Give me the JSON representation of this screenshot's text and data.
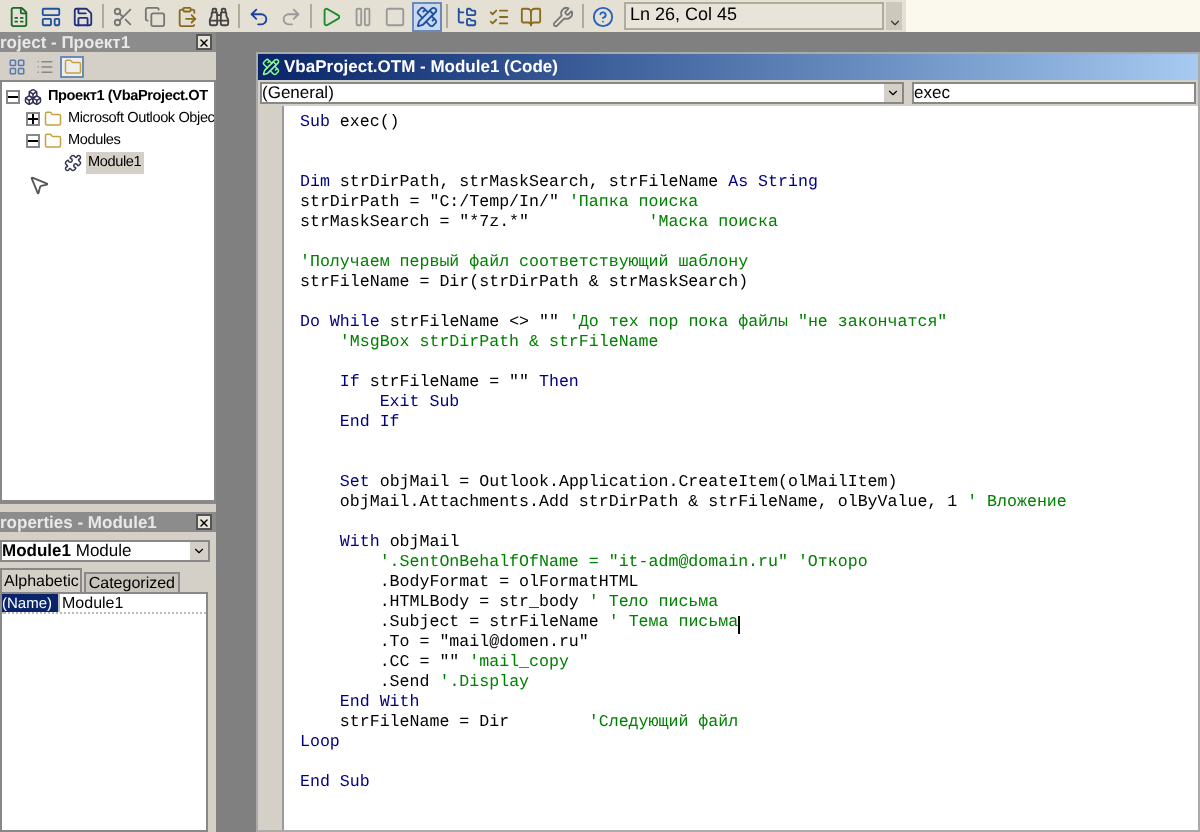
{
  "toolbar": {
    "buttons": [
      {
        "pressed": false
      },
      {
        "pressed": false
      },
      {
        "pressed": false
      },
      {
        "pressed": false
      },
      {
        "pressed": false
      },
      {
        "pressed": false
      },
      {
        "pressed": false
      },
      {
        "pressed": false
      },
      {
        "pressed": false
      },
      {
        "pressed": false
      },
      {
        "pressed": false
      },
      {
        "pressed": false
      },
      {
        "pressed": true
      },
      {
        "pressed": false
      },
      {
        "pressed": false
      },
      {
        "pressed": false
      },
      {
        "pressed": false
      },
      {
        "pressed": false
      }
    ],
    "position": "Ln 26, Col 45"
  },
  "project_explorer": {
    "title": "roject - Проект1",
    "tree": [
      {
        "label": "Проект1 (VbaProject.OT",
        "expanded": true,
        "selected": false,
        "children": [
          {
            "label": "Microsoft Outlook Objec",
            "expanded": false,
            "selected": false
          },
          {
            "label": "Modules",
            "expanded": true,
            "selected": false,
            "children": [
              {
                "label": "Module1",
                "selected": true
              }
            ]
          }
        ]
      }
    ]
  },
  "properties": {
    "title": "roperties - Module1",
    "object_name": "Module1",
    "object_type": "Module",
    "tabs": [
      {
        "label": "Alphabetic",
        "selected": true
      },
      {
        "label": "Categorized",
        "selected": false
      }
    ],
    "rows": [
      {
        "name": "(Name)",
        "value": "Module1",
        "selected": true
      }
    ]
  },
  "code_window": {
    "title": "VbaProject.OTM - Module1 (Code)",
    "object_combo": "(General)",
    "procedure_combo": "exec",
    "lines": [
      {
        "kind": "code",
        "segments": [
          {
            "kind": "keyword",
            "text": "Sub"
          },
          {
            "kind": "plain",
            "text": " exec()"
          }
        ]
      },
      {
        "kind": "blank"
      },
      {
        "kind": "blank"
      },
      {
        "kind": "code",
        "segments": [
          {
            "kind": "keyword",
            "text": "Dim"
          },
          {
            "kind": "plain",
            "text": " strDirPath, strMaskSearch, strFileName "
          },
          {
            "kind": "keyword",
            "text": "As String"
          }
        ]
      },
      {
        "kind": "code",
        "segments": [
          {
            "kind": "plain",
            "text": "strDirPath = \"C:/Temp/In/\" "
          },
          {
            "kind": "comment",
            "text": "'Папка поиска"
          }
        ]
      },
      {
        "kind": "code",
        "segments": [
          {
            "kind": "plain",
            "text": "strMaskSearch = \"*7z.*\"            "
          },
          {
            "kind": "comment",
            "text": "'Маска поиска"
          }
        ]
      },
      {
        "kind": "blank"
      },
      {
        "kind": "code",
        "segments": [
          {
            "kind": "comment",
            "text": "'Получаем первый файл соответствующий шаблону"
          }
        ]
      },
      {
        "kind": "code",
        "segments": [
          {
            "kind": "plain",
            "text": "strFileName = Dir(strDirPath & strMaskSearch)"
          }
        ]
      },
      {
        "kind": "blank"
      },
      {
        "kind": "code",
        "segments": [
          {
            "kind": "keyword",
            "text": "Do While"
          },
          {
            "kind": "plain",
            "text": " strFileName <> \"\" "
          },
          {
            "kind": "comment",
            "text": "'До тех пор пока файлы \"не закончатся\""
          }
        ]
      },
      {
        "kind": "code",
        "segments": [
          {
            "kind": "comment",
            "text": "    'MsgBox strDirPath & strFileName"
          }
        ]
      },
      {
        "kind": "blank"
      },
      {
        "kind": "code",
        "segments": [
          {
            "kind": "keyword",
            "text": "    If"
          },
          {
            "kind": "plain",
            "text": " strFileName = \"\" "
          },
          {
            "kind": "keyword",
            "text": "Then"
          }
        ]
      },
      {
        "kind": "code",
        "segments": [
          {
            "kind": "keyword",
            "text": "        Exit Sub"
          }
        ]
      },
      {
        "kind": "code",
        "segments": [
          {
            "kind": "keyword",
            "text": "    End If"
          }
        ]
      },
      {
        "kind": "blank"
      },
      {
        "kind": "blank"
      },
      {
        "kind": "code",
        "segments": [
          {
            "kind": "keyword",
            "text": "    Set"
          },
          {
            "kind": "plain",
            "text": " objMail = Outlook.Application.CreateItem(olMailItem)"
          }
        ]
      },
      {
        "kind": "code",
        "segments": [
          {
            "kind": "plain",
            "text": "    objMail.Attachments.Add strDirPath & strFileName, olByValue, 1 "
          },
          {
            "kind": "comment",
            "text": "' Вложение"
          }
        ]
      },
      {
        "kind": "blank"
      },
      {
        "kind": "code",
        "segments": [
          {
            "kind": "keyword",
            "text": "    With"
          },
          {
            "kind": "plain",
            "text": " objMail"
          }
        ]
      },
      {
        "kind": "code",
        "segments": [
          {
            "kind": "comment",
            "text": "        '.SentOnBehalfOfName = \"it-adm@domain.ru\" 'Откоро"
          }
        ]
      },
      {
        "kind": "code",
        "segments": [
          {
            "kind": "plain",
            "text": "        .BodyFormat = olFormatHTML"
          }
        ]
      },
      {
        "kind": "code",
        "segments": [
          {
            "kind": "plain",
            "text": "        .HTMLBody = str_body "
          },
          {
            "kind": "comment",
            "text": "' Тело письма"
          }
        ]
      },
      {
        "kind": "code",
        "segments": [
          {
            "kind": "plain",
            "text": "        .Subject = strFileName "
          },
          {
            "kind": "comment",
            "text": "' Тема письма"
          }
        ],
        "cursor": true
      },
      {
        "kind": "code",
        "segments": [
          {
            "kind": "plain",
            "text": "        .To = \"mail@domen.ru\""
          }
        ]
      },
      {
        "kind": "code",
        "segments": [
          {
            "kind": "plain",
            "text": "        .CC = \"\" "
          },
          {
            "kind": "comment",
            "text": "'mail_copy"
          }
        ]
      },
      {
        "kind": "code",
        "segments": [
          {
            "kind": "plain",
            "text": "        .Send "
          },
          {
            "kind": "comment",
            "text": "'.Display"
          }
        ]
      },
      {
        "kind": "code",
        "segments": [
          {
            "kind": "keyword",
            "text": "    End With"
          }
        ]
      },
      {
        "kind": "code",
        "segments": [
          {
            "kind": "plain",
            "text": "    strFileName = Dir        "
          },
          {
            "kind": "comment",
            "text": "'Следующий файл"
          }
        ]
      },
      {
        "kind": "code",
        "segments": [
          {
            "kind": "keyword",
            "text": "Loop"
          }
        ]
      },
      {
        "kind": "blank"
      },
      {
        "kind": "code",
        "segments": [
          {
            "kind": "keyword",
            "text": "End Sub"
          }
        ]
      }
    ]
  }
}
